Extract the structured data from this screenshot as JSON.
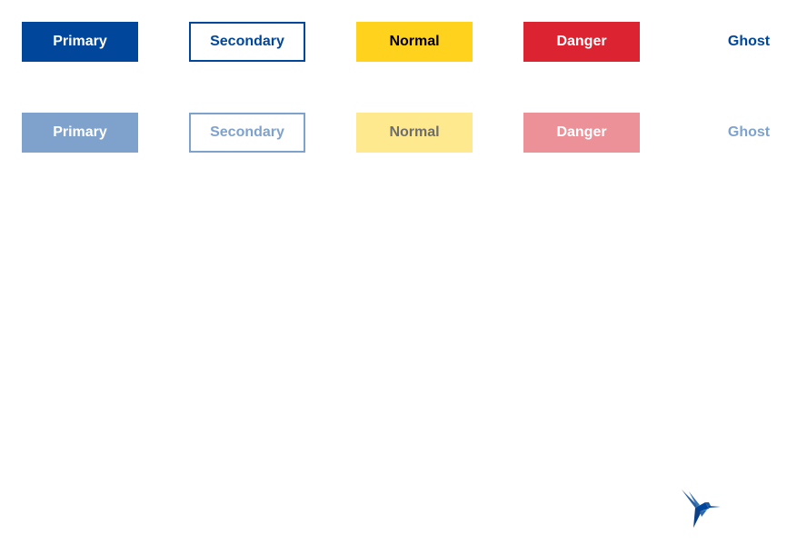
{
  "colors": {
    "primary": "#00469b",
    "normal": "#ffd21e",
    "danger": "#dc2332",
    "primary_disabled": "#7fa2cd",
    "normal_disabled": "#ffe98e",
    "danger_disabled": "#ed9198"
  },
  "enabled_buttons": {
    "primary": "Primary",
    "secondary": "Secondary",
    "normal": "Normal",
    "danger": "Danger",
    "ghost": "Ghost"
  },
  "disabled_buttons": {
    "primary": "Primary",
    "secondary": "Secondary",
    "normal": "Normal",
    "danger": "Danger",
    "ghost": "Ghost"
  },
  "logo": {
    "icon": "hummingbird-icon"
  }
}
